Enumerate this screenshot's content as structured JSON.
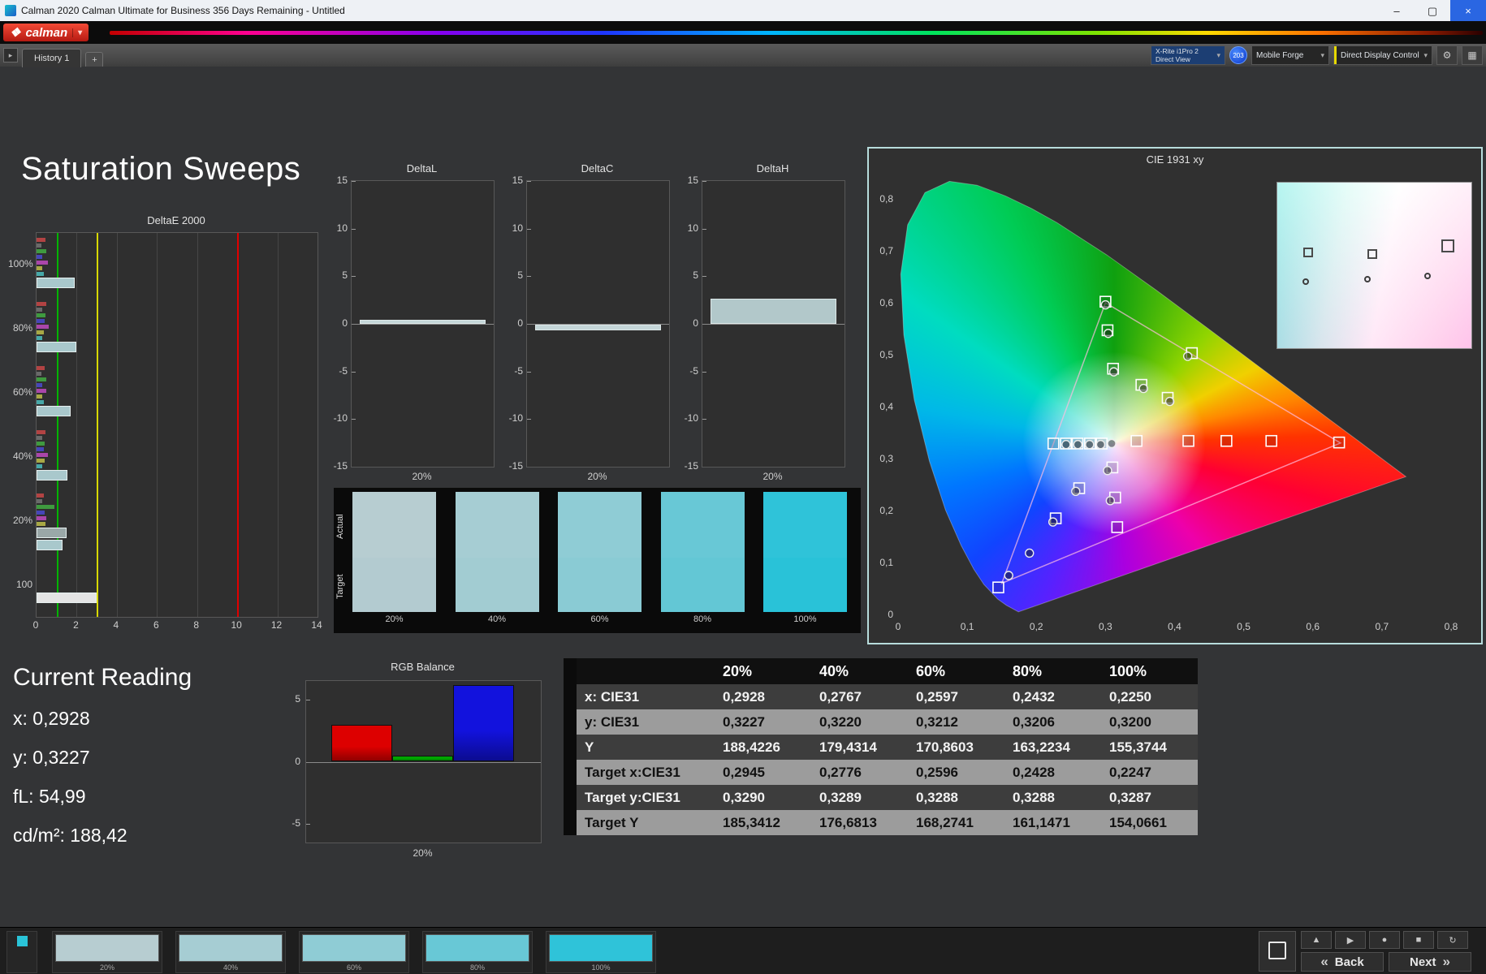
{
  "window": {
    "title": "Calman 2020 Calman Ultimate for Business 356 Days Remaining - Untitled",
    "minimize": "–",
    "maximize": "▢",
    "close": "×"
  },
  "icons": {
    "caret_down": "▾",
    "panel_arrow": "▸",
    "gear": "⚙",
    "grid": "▦",
    "diamond": "❖",
    "back_arrows": "«",
    "next_arrows": "»"
  },
  "brand": {
    "logo": "calman"
  },
  "tabbar": {
    "history_tab": "History 1",
    "add_tab": "+",
    "meter_line1": "X-Rite i1Pro 2",
    "meter_line2": "Direct View",
    "badge": "203",
    "pattern_source": "Mobile Forge",
    "display_control": "Direct Display Control"
  },
  "page_title": "Saturation Sweeps",
  "current_reading": {
    "title": "Current Reading",
    "lines": [
      "x: 0,2928",
      "y: 0,3227",
      "fL: 54,99",
      "cd/m²: 188,42"
    ]
  },
  "chart_data": [
    {
      "id": "deltae2000",
      "type": "bar",
      "orientation": "horizontal",
      "title": "DeltaE 2000",
      "xlim": [
        0,
        14
      ],
      "xticks": [
        0,
        2,
        4,
        6,
        8,
        10,
        12,
        14
      ],
      "reference_lines": [
        {
          "value": 1,
          "color": "#00b400"
        },
        {
          "value": 3,
          "color": "#d8d800"
        },
        {
          "value": 10,
          "color": "#e00000"
        }
      ],
      "groups": [
        {
          "label": "100%",
          "bars": [
            [
              "#b24343",
              0.45
            ],
            [
              "#6a6a6a",
              0.25
            ],
            [
              "#3f9a3f",
              0.5
            ],
            [
              "#4646b8",
              0.3
            ],
            [
              "#aa46aa",
              0.55
            ],
            [
              "#a8a845",
              0.3
            ],
            [
              "#46a8a8",
              0.35
            ],
            [
              "#a9c8cc",
              1.9
            ]
          ]
        },
        {
          "label": "80%",
          "bars": [
            [
              "#b24343",
              0.5
            ],
            [
              "#6a6a6a",
              0.3
            ],
            [
              "#3f9a3f",
              0.45
            ],
            [
              "#4646b8",
              0.4
            ],
            [
              "#aa46aa",
              0.6
            ],
            [
              "#a8a845",
              0.35
            ],
            [
              "#46a8a8",
              0.3
            ],
            [
              "#a9c8cc",
              2.0
            ]
          ]
        },
        {
          "label": "60%",
          "bars": [
            [
              "#b24343",
              0.4
            ],
            [
              "#6a6a6a",
              0.25
            ],
            [
              "#3f9a3f",
              0.5
            ],
            [
              "#4646b8",
              0.3
            ],
            [
              "#aa46aa",
              0.5
            ],
            [
              "#a8a845",
              0.3
            ],
            [
              "#46a8a8",
              0.35
            ],
            [
              "#a9c8cc",
              1.7
            ]
          ]
        },
        {
          "label": "40%",
          "bars": [
            [
              "#b24343",
              0.45
            ],
            [
              "#6a6a6a",
              0.3
            ],
            [
              "#3f9a3f",
              0.4
            ],
            [
              "#4646b8",
              0.35
            ],
            [
              "#aa46aa",
              0.55
            ],
            [
              "#a8a845",
              0.4
            ],
            [
              "#46a8a8",
              0.3
            ],
            [
              "#a9c8cc",
              1.55
            ]
          ]
        },
        {
          "label": "20%",
          "bars": [
            [
              "#b24343",
              0.35
            ],
            [
              "#6a6a6a",
              0.3
            ],
            [
              "#3f9a3f",
              0.9
            ],
            [
              "#4646b8",
              0.4
            ],
            [
              "#aa46aa",
              0.5
            ],
            [
              "#a8a845",
              0.45
            ],
            [
              "#9aa8a8",
              1.5
            ],
            [
              "#a9c8cc",
              1.3
            ]
          ]
        },
        {
          "label": "100",
          "bars": [
            [
              "#e4e4e4",
              3.0
            ]
          ]
        }
      ]
    },
    {
      "id": "deltaL",
      "type": "bar",
      "title": "DeltaL",
      "ylim": [
        -15,
        15
      ],
      "yticks": [
        15,
        10,
        5,
        0,
        -5,
        -10,
        -15
      ],
      "categories": [
        "20%"
      ],
      "values": [
        0.4
      ],
      "bar_color": "#c4d6d8"
    },
    {
      "id": "deltaC",
      "type": "bar",
      "title": "DeltaC",
      "ylim": [
        -15,
        15
      ],
      "yticks": [
        15,
        10,
        5,
        0,
        -5,
        -10,
        -15
      ],
      "categories": [
        "20%"
      ],
      "values": [
        -0.6
      ],
      "bar_color": "#c4d6d8"
    },
    {
      "id": "deltaH",
      "type": "bar",
      "title": "DeltaH",
      "ylim": [
        -15,
        15
      ],
      "yticks": [
        15,
        10,
        5,
        0,
        -5,
        -10,
        -15
      ],
      "categories": [
        "20%"
      ],
      "values": [
        2.6
      ],
      "bar_color": "#b2c8ca"
    },
    {
      "id": "cie1931",
      "type": "scatter",
      "title": "CIE 1931 xy",
      "xlim": [
        0,
        0.8
      ],
      "ylim": [
        0,
        0.8
      ],
      "xticks": [
        "0",
        "0,1",
        "0,2",
        "0,3",
        "0,4",
        "0,5",
        "0,6",
        "0,7",
        "0,8"
      ],
      "yticks": [
        "0",
        "0,1",
        "0,2",
        "0,3",
        "0,4",
        "0,5",
        "0,6",
        "0,7",
        "0,8"
      ],
      "gamut_triangle": [
        [
          0.64,
          0.33
        ],
        [
          0.3,
          0.6
        ],
        [
          0.15,
          0.06
        ]
      ],
      "white_point": [
        0.3127,
        0.329
      ],
      "target_squares": [
        [
          0.2945,
          0.329
        ],
        [
          0.2776,
          0.329
        ],
        [
          0.2596,
          0.329
        ],
        [
          0.2428,
          0.329
        ],
        [
          0.2247,
          0.329
        ],
        [
          0.345,
          0.334
        ],
        [
          0.42,
          0.334
        ],
        [
          0.475,
          0.334
        ],
        [
          0.54,
          0.334
        ],
        [
          0.638,
          0.331
        ],
        [
          0.3,
          0.602
        ],
        [
          0.303,
          0.547
        ],
        [
          0.311,
          0.473
        ],
        [
          0.352,
          0.442
        ],
        [
          0.39,
          0.417
        ],
        [
          0.425,
          0.503
        ],
        [
          0.31,
          0.283
        ],
        [
          0.314,
          0.225
        ],
        [
          0.317,
          0.168
        ],
        [
          0.262,
          0.243
        ],
        [
          0.228,
          0.185
        ],
        [
          0.145,
          0.052
        ]
      ],
      "measured_points": [
        [
          0.293,
          0.327
        ],
        [
          0.277,
          0.327
        ],
        [
          0.26,
          0.327
        ],
        [
          0.243,
          0.327
        ],
        [
          0.309,
          0.329
        ],
        [
          0.3,
          0.596
        ],
        [
          0.304,
          0.541
        ],
        [
          0.312,
          0.467
        ],
        [
          0.355,
          0.435
        ],
        [
          0.393,
          0.41
        ],
        [
          0.419,
          0.497
        ],
        [
          0.303,
          0.277
        ],
        [
          0.307,
          0.219
        ],
        [
          0.257,
          0.237
        ],
        [
          0.224,
          0.178
        ],
        [
          0.19,
          0.118
        ],
        [
          0.16,
          0.075
        ]
      ],
      "spectral_locus": [
        [
          0.1741,
          0.005
        ],
        [
          0.1566,
          0.0177
        ],
        [
          0.144,
          0.0297
        ],
        [
          0.1241,
          0.0578
        ],
        [
          0.1096,
          0.0868
        ],
        [
          0.0913,
          0.1327
        ],
        [
          0.0687,
          0.2007
        ],
        [
          0.0454,
          0.295
        ],
        [
          0.0235,
          0.4127
        ],
        [
          0.0082,
          0.5384
        ],
        [
          0.0039,
          0.6548
        ],
        [
          0.0139,
          0.7502
        ],
        [
          0.0389,
          0.812
        ],
        [
          0.0743,
          0.8338
        ],
        [
          0.1142,
          0.8262
        ],
        [
          0.1547,
          0.8059
        ],
        [
          0.1929,
          0.7816
        ],
        [
          0.2296,
          0.7543
        ],
        [
          0.3016,
          0.6923
        ],
        [
          0.3731,
          0.6245
        ],
        [
          0.4441,
          0.5547
        ],
        [
          0.5125,
          0.4866
        ],
        [
          0.5752,
          0.4242
        ],
        [
          0.627,
          0.3725
        ],
        [
          0.6658,
          0.334
        ],
        [
          0.6915,
          0.3083
        ],
        [
          0.7347,
          0.2653
        ]
      ]
    },
    {
      "id": "rgb_balance",
      "type": "bar",
      "title": "RGB Balance",
      "categories": [
        "20%"
      ],
      "ylim": [
        -6.5,
        6.5
      ],
      "yticks": [
        5,
        0,
        -5
      ],
      "series": [
        {
          "name": "Red",
          "value": 3.0,
          "color": "#dd0000"
        },
        {
          "name": "Green",
          "value": 0.5,
          "color": "#00a400"
        },
        {
          "name": "Blue",
          "value": 6.2,
          "color": "#1212dd"
        }
      ]
    },
    {
      "id": "saturation_table",
      "type": "table",
      "columns": [
        "20%",
        "40%",
        "60%",
        "80%",
        "100%"
      ],
      "rows": [
        {
          "label": "x: CIE31",
          "values": [
            "0,2928",
            "0,2767",
            "0,2597",
            "0,2432",
            "0,2250"
          ]
        },
        {
          "label": "y: CIE31",
          "values": [
            "0,3227",
            "0,3220",
            "0,3212",
            "0,3206",
            "0,3200"
          ]
        },
        {
          "label": "Y",
          "values": [
            "188,4226",
            "179,4314",
            "170,8603",
            "163,2234",
            "155,3744"
          ]
        },
        {
          "label": "Target x:CIE31",
          "values": [
            "0,2945",
            "0,2776",
            "0,2596",
            "0,2428",
            "0,2247"
          ]
        },
        {
          "label": "Target y:CIE31",
          "values": [
            "0,3290",
            "0,3289",
            "0,3288",
            "0,3288",
            "0,3287"
          ]
        },
        {
          "label": "Target Y",
          "values": [
            "185,3412",
            "176,6813",
            "168,2741",
            "161,1471",
            "154,0661"
          ]
        }
      ]
    }
  ],
  "swatches": {
    "row_labels": [
      "Actual",
      "Target"
    ],
    "columns": [
      {
        "label": "20%",
        "actual": "#b7cdd1",
        "target": "#b3cbd0"
      },
      {
        "label": "40%",
        "actual": "#a6cdd3",
        "target": "#a2ccd2"
      },
      {
        "label": "60%",
        "actual": "#8fccd5",
        "target": "#8acbd4"
      },
      {
        "label": "80%",
        "actual": "#68c8d6",
        "target": "#63c7d5"
      },
      {
        "label": "100%",
        "actual": "#2fc3d9",
        "target": "#29c2d8"
      }
    ]
  },
  "cie_inset": {
    "squares": [
      [
        0.16,
        0.42
      ],
      [
        0.49,
        0.43
      ],
      [
        0.88,
        0.38
      ]
    ],
    "circles": [
      [
        0.145,
        0.6
      ],
      [
        0.465,
        0.585
      ],
      [
        0.775,
        0.565
      ]
    ]
  },
  "bottom_bar": {
    "thumbnails": [
      {
        "label": "20%",
        "color": "#b7cdd1"
      },
      {
        "label": "40%",
        "color": "#a6cdd3"
      },
      {
        "label": "60%",
        "color": "#8fccd5"
      },
      {
        "label": "80%",
        "color": "#68c8d6"
      },
      {
        "label": "100%",
        "color": "#2fc3d9"
      }
    ],
    "tool_icons": [
      {
        "name": "eject-icon",
        "glyph": "▲"
      },
      {
        "name": "play-icon",
        "glyph": "▶"
      },
      {
        "name": "record-icon",
        "glyph": "●"
      },
      {
        "name": "stop-icon",
        "glyph": "■"
      },
      {
        "name": "refresh-icon",
        "glyph": "↻"
      }
    ],
    "back_label": "Back",
    "next_label": "Next"
  }
}
